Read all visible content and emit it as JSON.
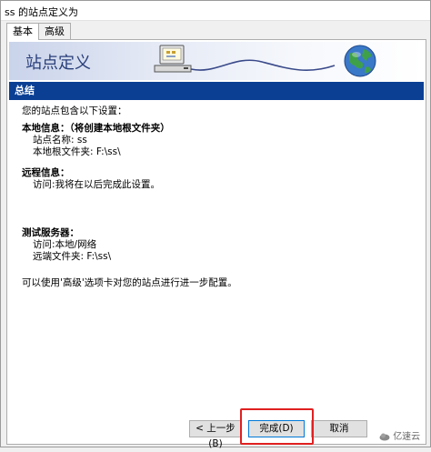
{
  "window": {
    "title": "ss 的站点定义为"
  },
  "tabs": [
    {
      "label": "基本"
    },
    {
      "label": "高级"
    }
  ],
  "banner": {
    "title": "站点定义"
  },
  "section": {
    "title": "总结"
  },
  "summary": {
    "intro": "您的站点包含以下设置：",
    "local": {
      "heading": "本地信息：（将创建本地根文件夹）",
      "site_name": "站点名称: ss",
      "root_folder": "本地根文件夹: F:\\ss\\"
    },
    "remote": {
      "heading": "远程信息：",
      "access": "访问:我将在以后完成此设置。"
    },
    "test_server": {
      "heading": "测试服务器：",
      "access": "访问:本地/网络",
      "remote_folder": "远端文件夹: F:\\ss\\"
    },
    "footer": "可以使用'高级'选项卡对您的站点进行进一步配置。"
  },
  "buttons": {
    "back": "< 上一步(B)",
    "finish": "完成(D)",
    "cancel": "取消"
  },
  "watermark": {
    "text": "亿速云"
  },
  "colors": {
    "section_bar": "#0a3f94",
    "banner_title": "#2a3f7a",
    "highlight": "#e02020"
  }
}
